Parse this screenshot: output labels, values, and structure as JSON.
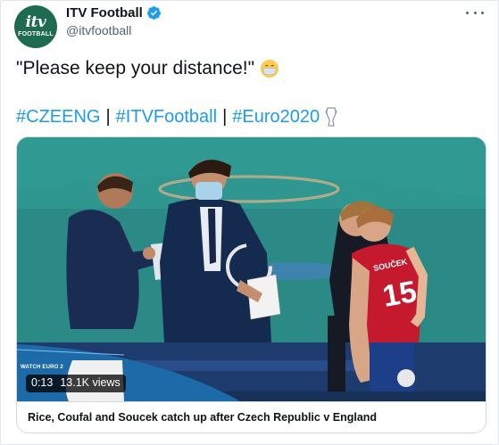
{
  "account": {
    "name": "ITV Football",
    "handle": "@itvfootball",
    "avatar_line1": "itv",
    "avatar_line2": "FOOTBALL"
  },
  "tweet": {
    "text": "\"Please keep your distance!\"",
    "hashtags": [
      "#CZEENG",
      "#ITVFootball",
      "#Euro2020"
    ],
    "separator": "|"
  },
  "media": {
    "duration": "0:13",
    "views": "13.1K views",
    "watch_overlay": "WATCH EURO 2",
    "title": "Rice, Coufal and Soucek catch up after Czech Republic v England",
    "shirt_name": "SOUČEK",
    "shirt_number": "15"
  },
  "colors": {
    "link": "#1d9bf0",
    "verified": "#1d9bf0",
    "avatar_bg": "#1f6b52"
  }
}
